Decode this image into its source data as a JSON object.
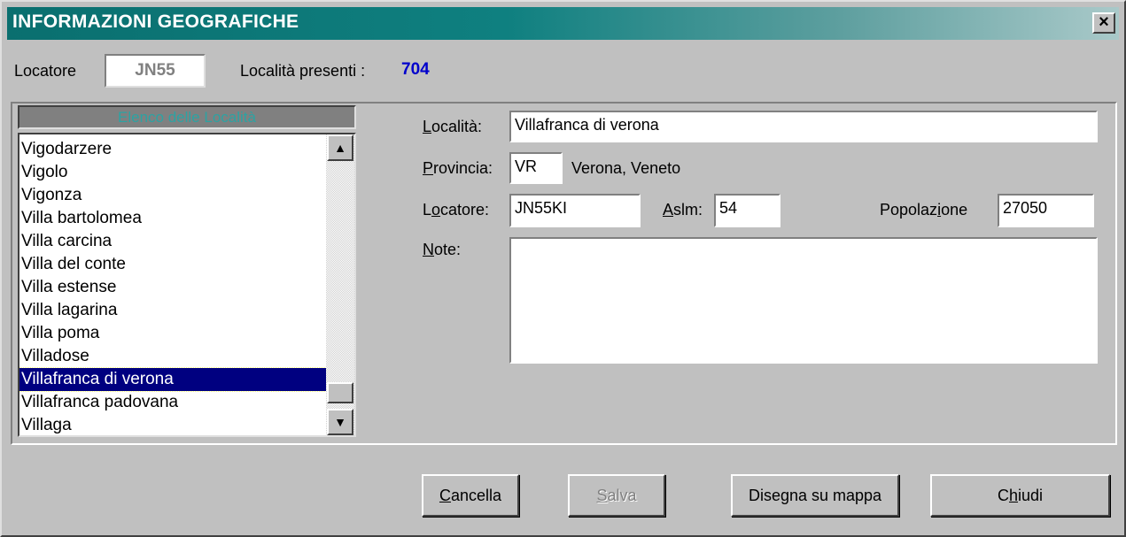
{
  "window": {
    "title": "INFORMAZIONI GEOGRAFICHE",
    "close_label": "×"
  },
  "header": {
    "locator_label": "Locatore",
    "locator_value": "JN55",
    "count_label": "Località presenti :",
    "count_value": "704"
  },
  "list": {
    "header": "Elenco delle Località",
    "items": [
      "Vigodarzere",
      "Vigolo",
      "Vigonza",
      "Villa bartolomea",
      "Villa carcina",
      "Villa del conte",
      "Villa estense",
      "Villa lagarina",
      "Villa poma",
      "Villadose",
      "Villafranca di verona",
      "Villafranca padovana",
      "Villaga"
    ],
    "selected_index": 10
  },
  "form": {
    "localita_label": "Località:",
    "localita_value": "Villafranca di verona",
    "provincia_label": "Provincia:",
    "provincia_value": "VR",
    "provincia_desc": "Verona, Veneto",
    "locatore_label": "Locatore:",
    "locatore_value": "JN55KI",
    "aslm_label": "Aslm:",
    "aslm_value": "54",
    "popolazione_label": "Popolazione",
    "popolazione_value": "27050",
    "note_label": "Note:",
    "note_value": ""
  },
  "buttons": {
    "cancella": "Cancella",
    "salva": "Salva",
    "disegna": "Disegna su mappa",
    "chiudi": "Chiudi"
  },
  "colors": {
    "title_bar_start": "#0a6f6f",
    "selection": "#000080",
    "count_value": "#0000cc"
  }
}
